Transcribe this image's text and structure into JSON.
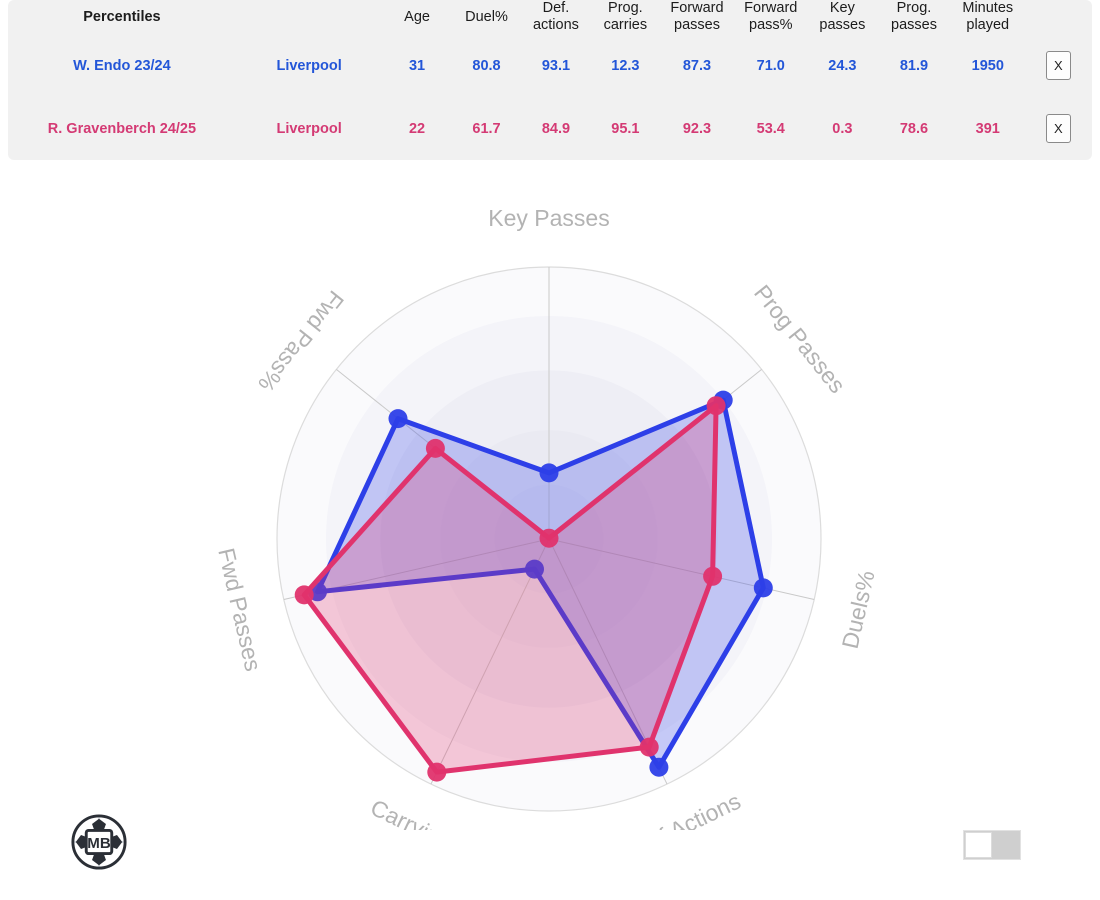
{
  "panel": {
    "title": "Percentiles",
    "columns": [
      {
        "key": "age",
        "lines": [
          "Age"
        ]
      },
      {
        "key": "duel",
        "lines": [
          "Duel%"
        ]
      },
      {
        "key": "def",
        "lines": [
          "Def.",
          "actions"
        ]
      },
      {
        "key": "prog_carry",
        "lines": [
          "Prog.",
          "carries"
        ]
      },
      {
        "key": "fwd_pass",
        "lines": [
          "Forward",
          "passes"
        ]
      },
      {
        "key": "fwd_pct",
        "lines": [
          "Forward",
          "pass%"
        ]
      },
      {
        "key": "key_pass",
        "lines": [
          "Key",
          "passes"
        ]
      },
      {
        "key": "prog_pass",
        "lines": [
          "Prog.",
          "passes"
        ]
      },
      {
        "key": "minutes",
        "lines": [
          "Minutes",
          "played"
        ]
      }
    ],
    "rows": [
      {
        "name": "W. Endo 23/24",
        "team": "Liverpool",
        "color": "#2356d8",
        "values": [
          "31",
          "80.8",
          "93.1",
          "12.3",
          "87.3",
          "71.0",
          "24.3",
          "81.9",
          "1950"
        ],
        "close_label": "X"
      },
      {
        "name": "R. Gravenberch 24/25",
        "team": "Liverpool",
        "color": "#d43a74",
        "values": [
          "22",
          "61.7",
          "84.9",
          "95.1",
          "92.3",
          "53.4",
          "0.3",
          "78.6",
          "391"
        ],
        "close_label": "X"
      }
    ]
  },
  "footer": {
    "logo_text": "MB",
    "toggle_state": "off"
  },
  "chart_data": {
    "type": "radar",
    "title": "",
    "axes": [
      "Key Passes",
      "Prog Passes",
      "Duels%",
      "Def Actions",
      "Carrying",
      "Fwd Passes",
      "Fwd Pass%"
    ],
    "range": [
      0,
      100
    ],
    "grid": true,
    "grid_rings": [
      20,
      40,
      60,
      80,
      100
    ],
    "legend": "none",
    "series": [
      {
        "name": "W. Endo 23/24",
        "color": "#2d3fe8",
        "fill": "#2d3fe8",
        "values": [
          24.3,
          81.9,
          80.8,
          93.1,
          12.3,
          87.3,
          71.0
        ]
      },
      {
        "name": "R. Gravenberch 24/25",
        "color": "#e0336d",
        "fill": "#e0336d",
        "values": [
          0.3,
          78.6,
          61.7,
          84.9,
          95.1,
          92.3,
          53.4
        ]
      }
    ]
  }
}
